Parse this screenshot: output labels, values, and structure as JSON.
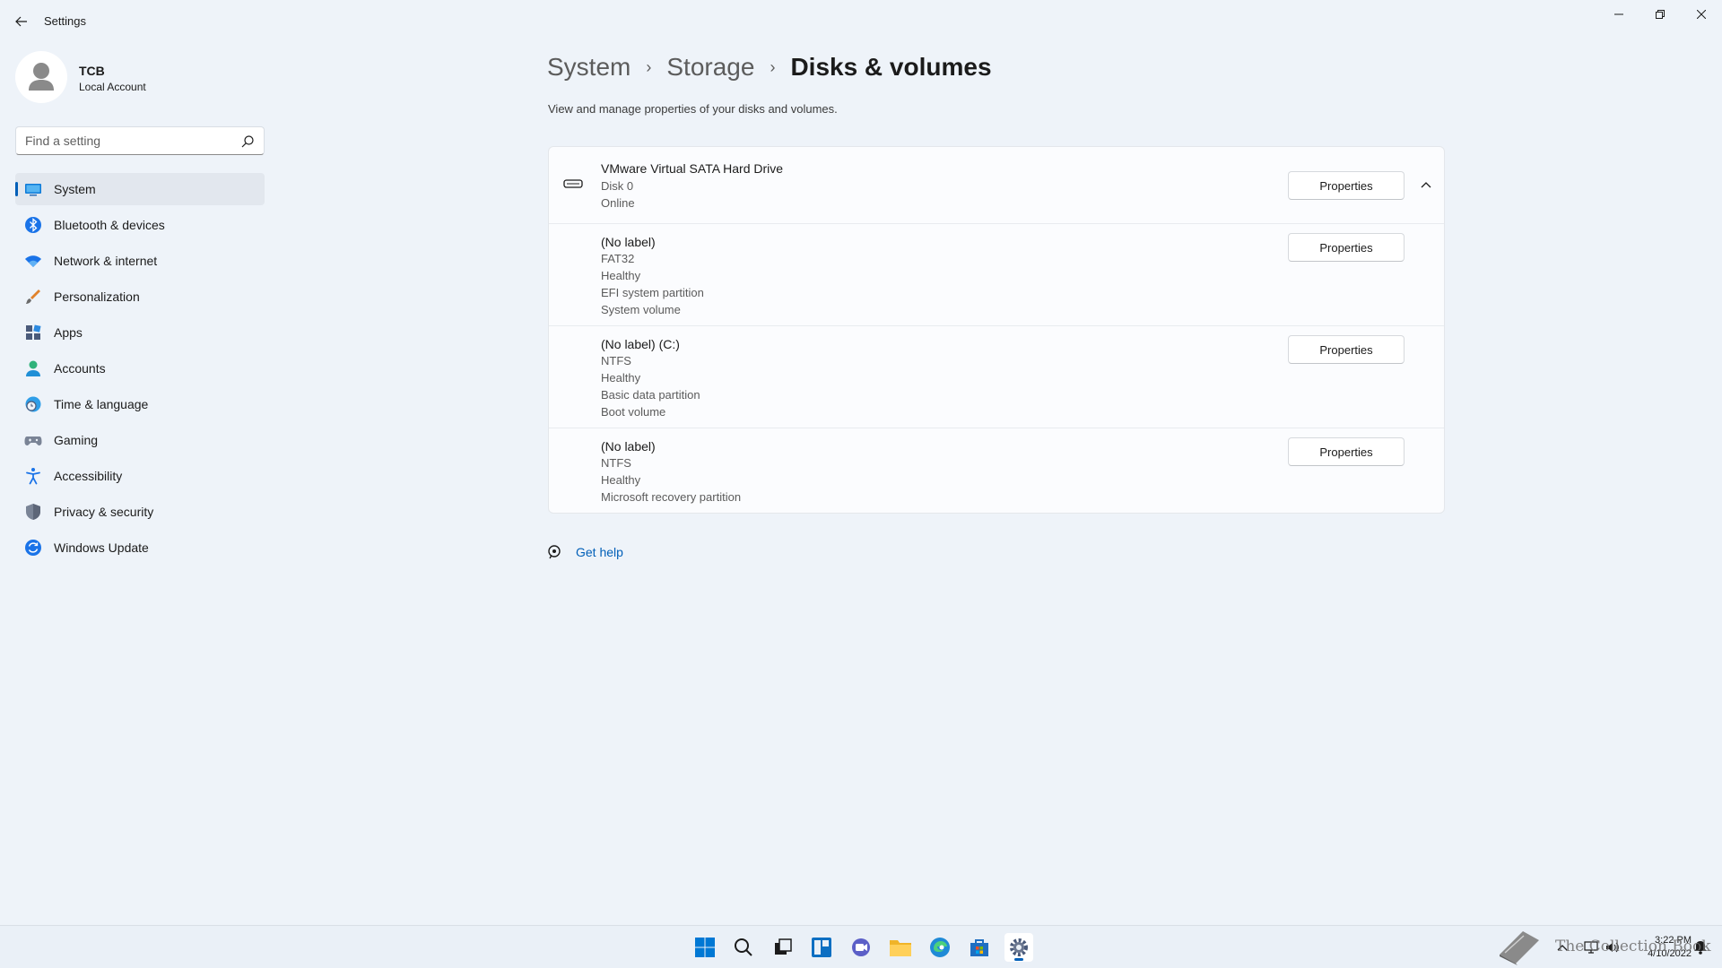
{
  "window": {
    "title": "Settings",
    "controls": [
      "minimize-icon",
      "restore-icon",
      "close-icon"
    ]
  },
  "profile": {
    "name": "TCB",
    "account_type": "Local Account"
  },
  "search": {
    "placeholder": "Find a setting",
    "value": ""
  },
  "sidebar": {
    "items": [
      {
        "label": "System",
        "icon": "system-icon",
        "selected": true
      },
      {
        "label": "Bluetooth & devices",
        "icon": "bluetooth-icon"
      },
      {
        "label": "Network & internet",
        "icon": "wifi-icon"
      },
      {
        "label": "Personalization",
        "icon": "brush-icon"
      },
      {
        "label": "Apps",
        "icon": "apps-icon"
      },
      {
        "label": "Accounts",
        "icon": "person-icon"
      },
      {
        "label": "Time & language",
        "icon": "globe-clock-icon"
      },
      {
        "label": "Gaming",
        "icon": "gamepad-icon"
      },
      {
        "label": "Accessibility",
        "icon": "accessibility-icon"
      },
      {
        "label": "Privacy & security",
        "icon": "shield-icon"
      },
      {
        "label": "Windows Update",
        "icon": "update-icon"
      }
    ]
  },
  "breadcrumb": {
    "items": [
      "System",
      "Storage"
    ],
    "current": "Disks & volumes"
  },
  "page": {
    "description": "View and manage properties of your disks and volumes."
  },
  "disk": {
    "name": "VMware Virtual SATA Hard Drive",
    "number": "Disk 0",
    "status": "Online",
    "button": "Properties"
  },
  "volumes": [
    {
      "lines": [
        "(No label)",
        "FAT32",
        "Healthy",
        "EFI system partition",
        "System volume"
      ],
      "button": "Properties"
    },
    {
      "lines": [
        "(No label) (C:)",
        "NTFS",
        "Healthy",
        "Basic data partition",
        "Boot volume"
      ],
      "button": "Properties"
    },
    {
      "lines": [
        "(No label)",
        "NTFS",
        "Healthy",
        "Microsoft recovery partition"
      ],
      "button": "Properties"
    }
  ],
  "help": {
    "label": "Get help"
  },
  "taskbar": {
    "apps": [
      "start-icon",
      "search-icon",
      "task-view-icon",
      "widgets-icon",
      "chat-icon",
      "file-explorer-icon",
      "edge-icon",
      "store-icon",
      "settings-icon"
    ],
    "active": "settings-icon",
    "clock_time": "3:22 PM",
    "clock_date": "4/10/2022"
  },
  "watermark": {
    "text": "The Collection Book"
  },
  "colors": {
    "accent": "#005fb8",
    "background": "#eef3f9",
    "card": "#fbfcfe"
  }
}
